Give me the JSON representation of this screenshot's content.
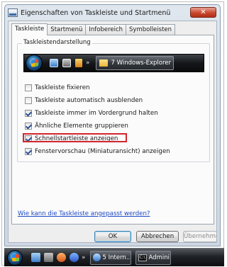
{
  "window": {
    "title": "Eigenschaften von Taskleiste und Startmenü",
    "close_icon": "close-icon"
  },
  "tabs": [
    {
      "label": "Taskleiste",
      "active": true
    },
    {
      "label": "Startmenü",
      "active": false
    },
    {
      "label": "Infobereich",
      "active": false
    },
    {
      "label": "Symbolleisten",
      "active": false
    }
  ],
  "taskbar_group": {
    "label": "Taskleistendarstellung",
    "preview_task_label": "7 Windows-Explorer",
    "icons": [
      "start-orb-icon",
      "show-desktop-icon",
      "switch-windows-icon",
      "media-player-icon",
      "chevron-right-icon",
      "folder-icon"
    ]
  },
  "options": [
    {
      "label": "Taskleiste fixieren",
      "checked": false
    },
    {
      "label": "Taskleiste automatisch ausblenden",
      "checked": false
    },
    {
      "label": "Taskleiste immer im Vordergrund halten",
      "checked": true
    },
    {
      "label": "Ähnliche Elemente gruppieren",
      "checked": true
    },
    {
      "label": "Schnellstartleiste anzeigen",
      "checked": true,
      "highlighted": true
    },
    {
      "label": "Fenstervorschau (Miniaturansicht) anzeigen",
      "checked": true
    }
  ],
  "highlight_color": "#d2262e",
  "help_link": "Wie kann die Taskleiste angepasst werden?",
  "buttons": {
    "ok": "OK",
    "cancel": "Abbrechen",
    "apply": "Übernehmen"
  },
  "system_taskbar": {
    "task1_label": "5 Intern...",
    "task2_label": "Admini",
    "icons": [
      "start-orb-icon",
      "show-desktop-icon",
      "switch-windows-icon",
      "firefox-icon",
      "globe-icon",
      "chevron-right-icon",
      "internet-explorer-icon",
      "command-prompt-icon"
    ]
  }
}
